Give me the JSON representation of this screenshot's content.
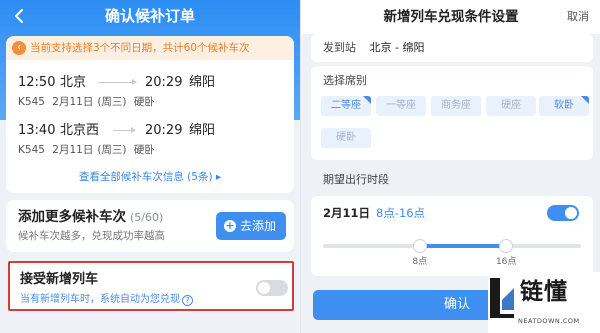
{
  "left": {
    "title": "确认候补订单",
    "notice": "当前支持选择3个不同日期，共计60个候补车次",
    "trips": [
      {
        "depart_time": "12:50",
        "depart_station": "北京",
        "arrive_time": "20:29",
        "arrive_station": "绵阳",
        "train": "K545",
        "date": "2月11日",
        "weekday": "(周三)",
        "seat": "硬卧"
      },
      {
        "depart_time": "13:40",
        "depart_station": "北京西",
        "arrive_time": "20:29",
        "arrive_station": "绵阳",
        "train": "K545",
        "date": "2月11日",
        "weekday": "(周三)",
        "seat": "硬卧"
      }
    ],
    "view_all": "查看全部候补车次信息 (5条) ▸",
    "add_more": {
      "title": "添加更多候补车次",
      "count": "(5/60)",
      "subtitle": "候补车次越多，兑现成功率越高",
      "button": "去添加"
    },
    "accept": {
      "title": "接受新增列车",
      "subtitle": "当有新增列车时，系统自动为您兑现",
      "help": "?",
      "enabled": false
    }
  },
  "right": {
    "title": "新增列车兑现条件设置",
    "cancel": "取消",
    "station": {
      "label": "发到站",
      "value": "北京 - 绵阳"
    },
    "seat_label": "选择席别",
    "seats": [
      {
        "label": "二等座",
        "selected": true
      },
      {
        "label": "一等座",
        "selected": false
      },
      {
        "label": "商务座",
        "selected": false
      },
      {
        "label": "硬座",
        "selected": false
      },
      {
        "label": "软卧",
        "selected": true
      },
      {
        "label": "硬卧",
        "selected": false
      }
    ],
    "period_title": "期望出行时段",
    "period": {
      "date": "2月11日",
      "range": "8点-16点",
      "enabled": true,
      "start_label": "8点",
      "end_label": "16点",
      "start_fraction": 0.375,
      "end_fraction": 0.71
    },
    "confirm": "确认"
  },
  "watermark": {
    "text": "链懂",
    "url": "NEATDOWN.COM"
  },
  "colors": {
    "primary": "#3f8ff0",
    "notice": "#ea7e27",
    "highlight_border": "#d63a3a"
  }
}
